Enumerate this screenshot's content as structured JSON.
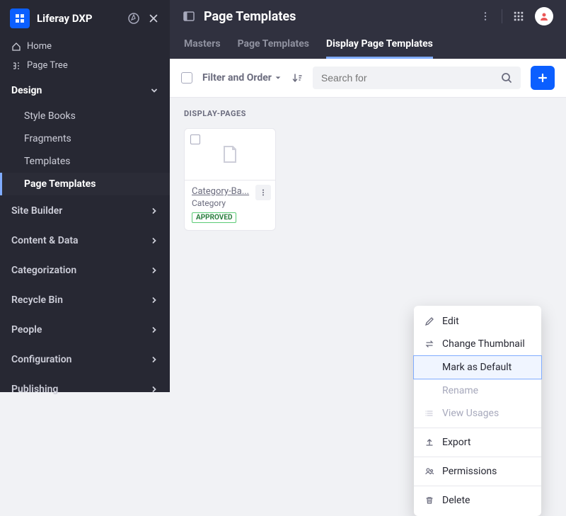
{
  "brand": {
    "name": "Liferay DXP"
  },
  "sidebar": {
    "home": "Home",
    "page_tree": "Page Tree",
    "sections": [
      {
        "label": "Design",
        "expanded": true,
        "items": [
          {
            "label": "Style Books",
            "active": false
          },
          {
            "label": "Fragments",
            "active": false
          },
          {
            "label": "Templates",
            "active": false
          },
          {
            "label": "Page Templates",
            "active": true
          }
        ]
      },
      {
        "label": "Site Builder",
        "expanded": false
      },
      {
        "label": "Content & Data",
        "expanded": false
      },
      {
        "label": "Categorization",
        "expanded": false
      },
      {
        "label": "Recycle Bin",
        "expanded": false
      },
      {
        "label": "People",
        "expanded": false
      },
      {
        "label": "Configuration",
        "expanded": false
      },
      {
        "label": "Publishing",
        "expanded": false
      }
    ]
  },
  "header": {
    "title": "Page Templates"
  },
  "tabs": [
    {
      "label": "Masters",
      "active": false
    },
    {
      "label": "Page Templates",
      "active": false
    },
    {
      "label": "Display Page Templates",
      "active": true
    }
  ],
  "toolbar": {
    "filter_label": "Filter and Order",
    "search_placeholder": "Search for"
  },
  "content": {
    "section_label": "DISPLAY-PAGES",
    "cards": [
      {
        "title": "Category-Ba...",
        "subtype": "Category",
        "status": "APPROVED"
      }
    ]
  },
  "context_menu": [
    {
      "label": "Edit",
      "icon": "pencil-icon",
      "disabled": false
    },
    {
      "label": "Change Thumbnail",
      "icon": "swap-icon",
      "disabled": false
    },
    {
      "label": "Mark as Default",
      "icon": "",
      "highlight": true
    },
    {
      "label": "Rename",
      "icon": "",
      "disabled": true
    },
    {
      "label": "View Usages",
      "icon": "list-icon",
      "disabled": true
    },
    {
      "separator": true
    },
    {
      "label": "Export",
      "icon": "upload-icon",
      "disabled": false
    },
    {
      "separator": true
    },
    {
      "label": "Permissions",
      "icon": "people-icon",
      "disabled": false
    },
    {
      "separator": true
    },
    {
      "label": "Delete",
      "icon": "trash-icon",
      "disabled": false
    }
  ],
  "colors": {
    "sidebar_bg": "#272833",
    "topbar_bg": "#30313f",
    "accent": "#0b5fff",
    "highlight": "#80acff",
    "approved_green": "#287d3c"
  }
}
